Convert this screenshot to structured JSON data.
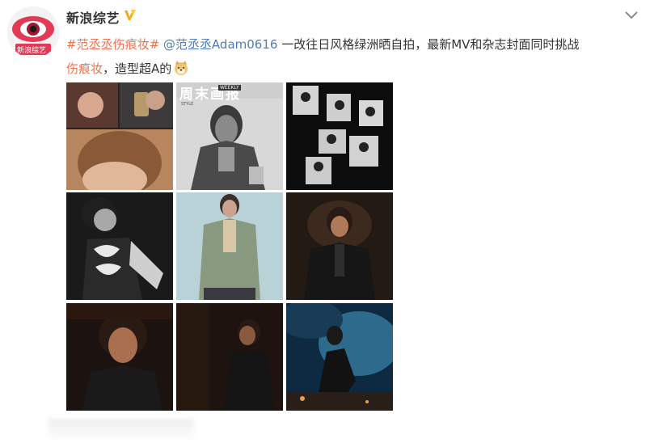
{
  "post": {
    "author": "新浪综艺",
    "avatar_badge": "新浪综艺",
    "verified_icon": "verified-v-icon",
    "menu_icon": "chevron-down-icon",
    "hashtag": "#范丞丞伤痕妆#",
    "mention": "@范丞丞Adam0616",
    "text_part1": " 一改往日风格绿洲晒自拍，最新MV和杂志封面同时挑战",
    "highlight": "伤痕妆",
    "text_part2": "，造型超A的",
    "emoji": "doge-emoji"
  },
  "photos": {
    "count": 9,
    "magazine_title": "周末画报",
    "magazine_sub": "WEEKLY",
    "magazine_style": "STYLE"
  }
}
